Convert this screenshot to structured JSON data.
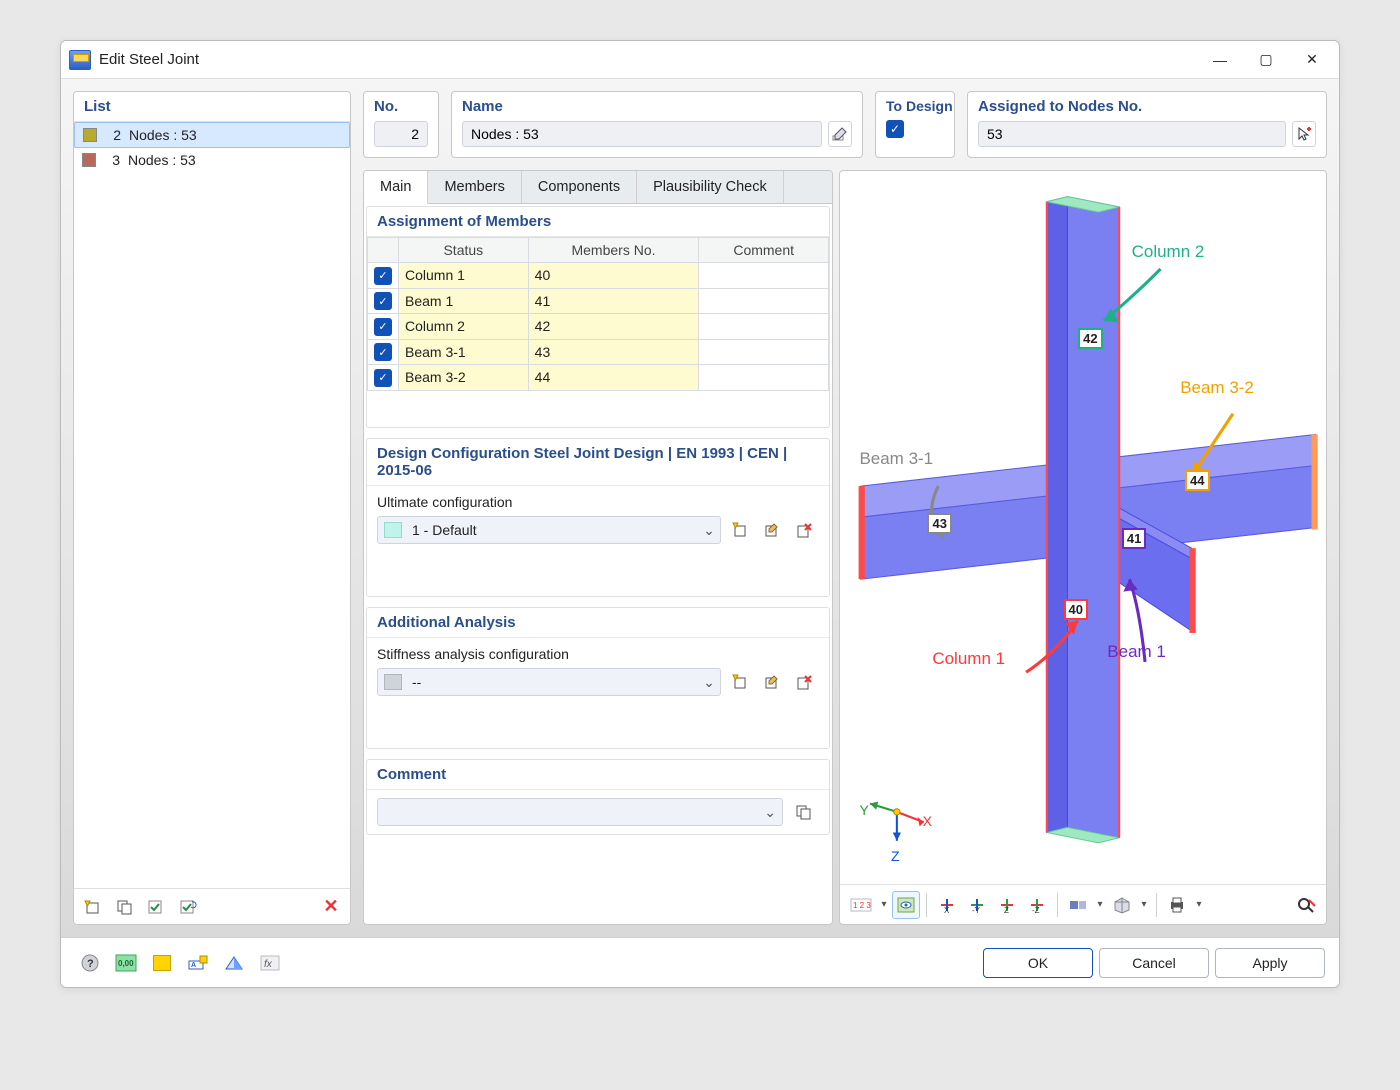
{
  "window": {
    "title": "Edit Steel Joint"
  },
  "list": {
    "header": "List",
    "items": [
      {
        "num": "2",
        "label": "Nodes : 53",
        "color": "#b7aa2e",
        "selected": true
      },
      {
        "num": "3",
        "label": "Nodes : 53",
        "color": "#b86a5a",
        "selected": false
      }
    ]
  },
  "header_boxes": {
    "no": {
      "label": "No.",
      "value": "2"
    },
    "name": {
      "label": "Name",
      "value": "Nodes : 53"
    },
    "todesign": {
      "label": "To Design",
      "checked": true
    },
    "nodes": {
      "label": "Assigned to Nodes No.",
      "value": "53"
    }
  },
  "tabs": {
    "items": [
      "Main",
      "Members",
      "Components",
      "Plausibility Check"
    ],
    "active": "Main"
  },
  "assignment": {
    "header": "Assignment of Members",
    "columns": {
      "status": "Status",
      "members_no": "Members No.",
      "comment": "Comment"
    },
    "rows": [
      {
        "status": "Column 1",
        "no": "40"
      },
      {
        "status": "Beam 1",
        "no": "41"
      },
      {
        "status": "Column 2",
        "no": "42"
      },
      {
        "status": "Beam 3-1",
        "no": "43"
      },
      {
        "status": "Beam 3-2",
        "no": "44"
      }
    ]
  },
  "design_config": {
    "header": "Design Configuration Steel Joint Design | EN 1993 | CEN | 2015-06",
    "label": "Ultimate configuration",
    "value": "1 - Default"
  },
  "analysis": {
    "header": "Additional Analysis",
    "label": "Stiffness analysis configuration",
    "value": "--"
  },
  "comment": {
    "header": "Comment",
    "value": ""
  },
  "viewer": {
    "axes": {
      "x": "X",
      "y": "Y",
      "z": "Z"
    },
    "labels": {
      "col1": "Column 1",
      "col2": "Column 2",
      "beam1": "Beam 1",
      "beam31": "Beam 3-1",
      "beam32": "Beam 3-2"
    },
    "tags": {
      "m40": "40",
      "m41": "41",
      "m42": "42",
      "m43": "43",
      "m44": "44"
    }
  },
  "buttons": {
    "ok": "OK",
    "cancel": "Cancel",
    "apply": "Apply"
  }
}
